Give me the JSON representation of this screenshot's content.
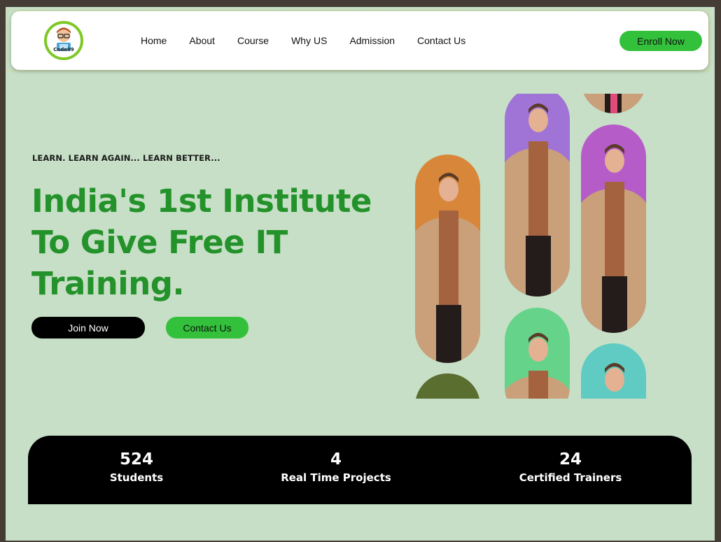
{
  "logo": {
    "text": "Code99",
    "icon": "cartoon-avatar-icon"
  },
  "nav": {
    "items": [
      {
        "label": "Home"
      },
      {
        "label": "About"
      },
      {
        "label": "Course"
      },
      {
        "label": "Why US"
      },
      {
        "label": "Admission"
      },
      {
        "label": "Contact Us"
      }
    ],
    "cta_label": "Enroll Now"
  },
  "hero": {
    "tagline": "LEARN. LEARN AGAIN... LEARN BETTER...",
    "headline": "India's 1st Institute To Give Free IT Training.",
    "join_label": "Join Now",
    "contact_label": "Contact Us"
  },
  "gallery": {
    "colors": {
      "orange": "#d8873a",
      "purple1": "#a073d6",
      "purple2": "#b55cc9",
      "green": "#66d38a",
      "teal": "#5fcbc2",
      "olive": "#5a6e30",
      "pink": "#d98590"
    }
  },
  "stats": [
    {
      "value": "524",
      "label": "Students"
    },
    {
      "value": "4",
      "label": "Real Time Projects"
    },
    {
      "value": "24",
      "label": "Certified Trainers"
    }
  ],
  "colors": {
    "background": "#c6dfc6",
    "accent_green": "#33c13b",
    "headline_green": "#24922a",
    "stats_bg": "#000000"
  }
}
